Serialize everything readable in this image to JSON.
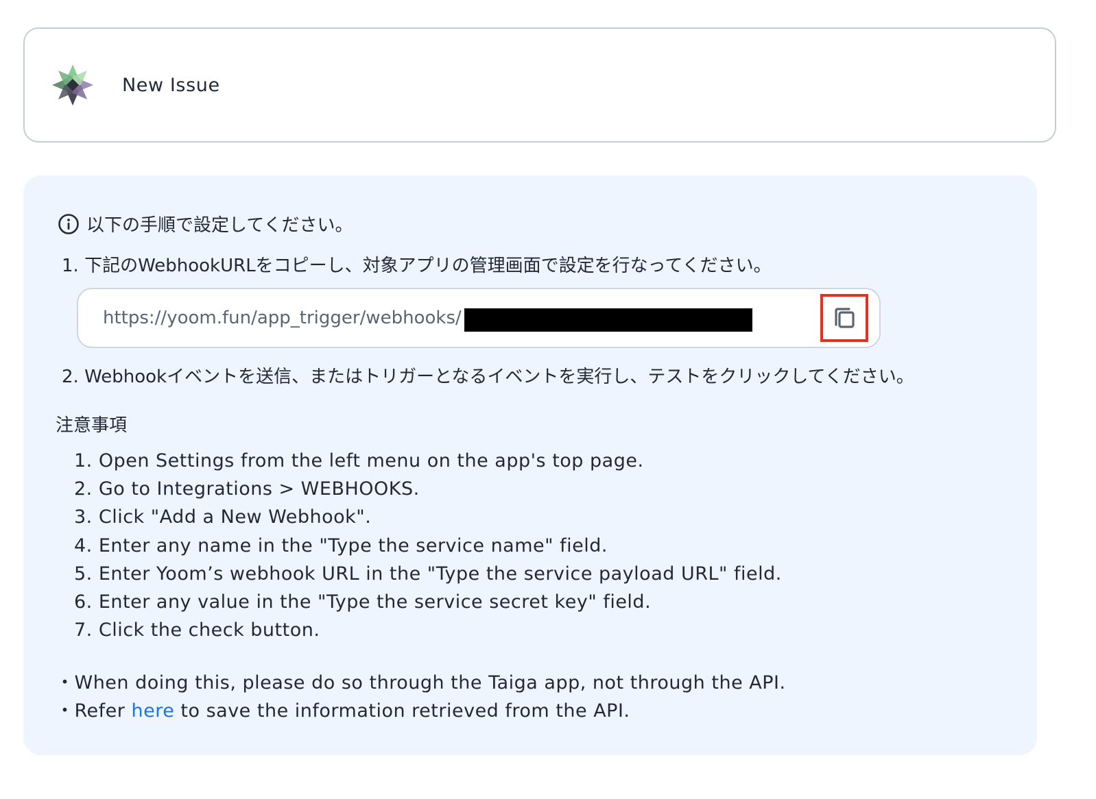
{
  "trigger": {
    "title": "New Issue",
    "app_icon": "taiga-logo"
  },
  "instructions": {
    "heading": "以下の手順で設定してください。",
    "heading_icon": "info-circle-icon",
    "step1": "1. 下記のWebhookURLをコピーし、対象アプリの管理画面で設定を行なってください。",
    "webhook_url_visible": "https://yoom.fun/app_trigger/webhooks/",
    "copy_icon": "copy-icon",
    "step2": "2. Webhookイベントを送信、またはトリガーとなるイベントを実行し、テストをクリックしてください。"
  },
  "notes": {
    "heading": "注意事項",
    "steps": [
      "1. Open Settings from the left menu on the app's top page.",
      "2. Go to Integrations > WEBHOOKS.",
      "3. Click \"Add a New Webhook\".",
      "4. Enter any name in the \"Type the service name\" field.",
      "5. Enter Yoom’s webhook URL in the \"Type the service payload URL\" field.",
      "6. Enter any value in the \"Type the service secret key\" field.",
      "7. Click the check button."
    ],
    "remark1": "・When doing this, please do so through the Taiga app, not through the API.",
    "remark2_prefix": "・Refer ",
    "remark2_link": "here",
    "remark2_suffix": " to save the information retrieved from the API."
  },
  "colors": {
    "panel_background": "#eff5fe",
    "link": "#1a73e8",
    "highlight_border": "#e8301f"
  }
}
